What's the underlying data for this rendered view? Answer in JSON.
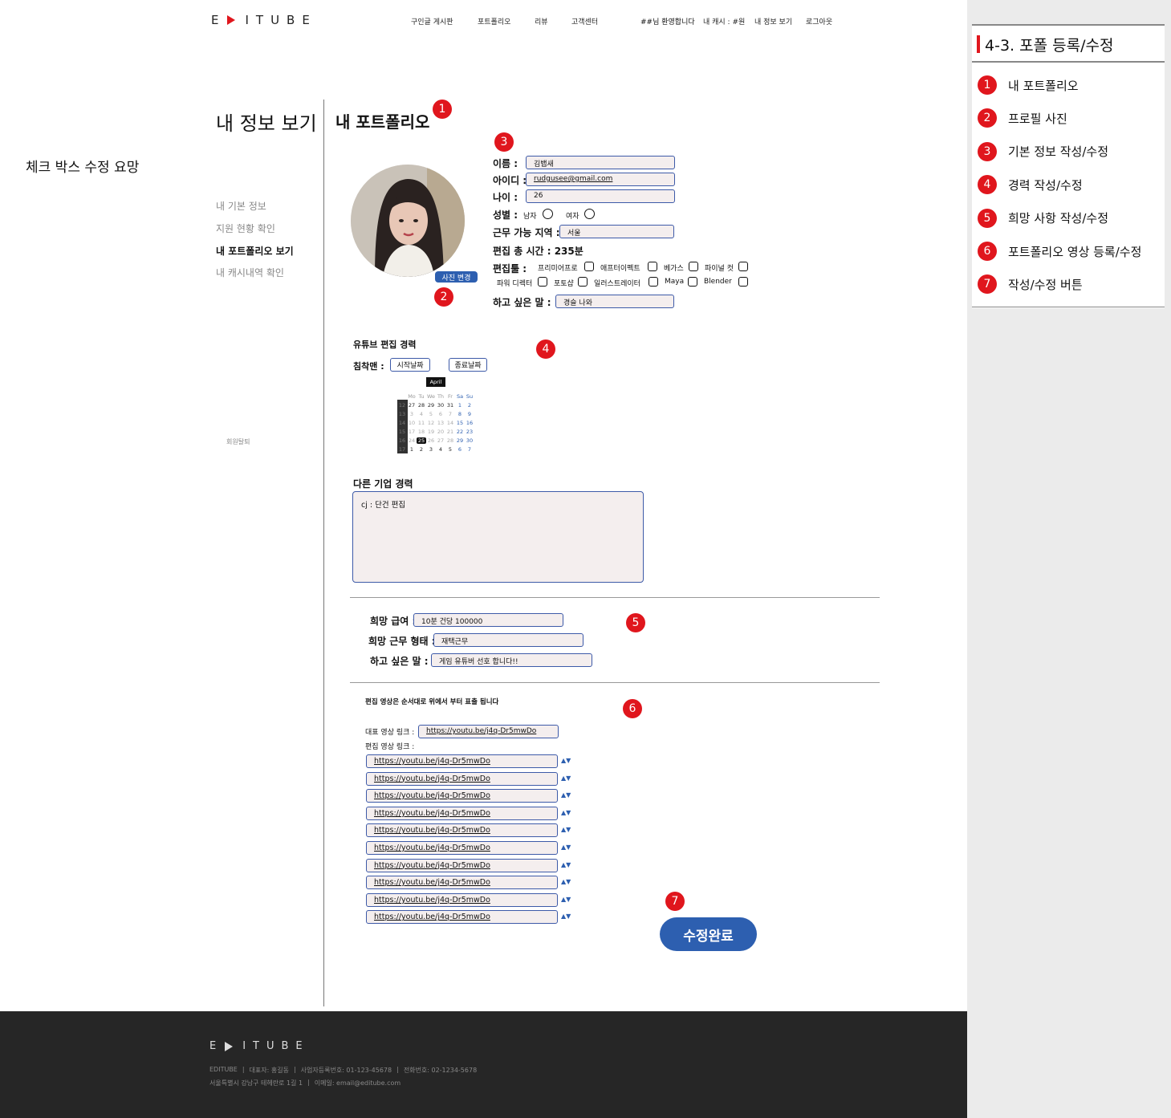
{
  "header": {
    "logo_left": "E",
    "logo_right": "ITUBE",
    "nav": [
      "구인글 게시판",
      "포트폴리오",
      "리뷰",
      "고객센터"
    ],
    "welcome": "##님 환영합니다",
    "cash": "내 캐시 : #원",
    "my_info": "내 정보 보기",
    "logout": "로그아웃"
  },
  "note": "체크 박스 수정 요망",
  "sidebar": {
    "title": "내 정보 보기",
    "items": [
      "내 기본 정보",
      "지원 현황 확인",
      "내 포트폴리오 보기",
      "내 캐시내역 확인"
    ],
    "active_index": 2,
    "withdraw": "회원탈퇴"
  },
  "main": {
    "title": "내 포트폴리오",
    "photo_button": "사진 변경",
    "basic": {
      "name_label": "이름 :",
      "name": "김뱁새",
      "id_label": "아이디 :",
      "id": "rudgusee@gmail.com",
      "age_label": "나이 :",
      "age": "26",
      "gender_label": "성별 :",
      "male": "남자",
      "female": "여자",
      "region_label": "근무 가능 지역 :",
      "region": "서울",
      "hours_label": "편집 총 시간 : 235분",
      "tools_label": "편집툴 :",
      "tools": [
        "프리미어프로",
        "애프터이펙트",
        "베가스",
        "파이널 컷",
        "파워 디렉터",
        "포토샵",
        "일러스트레이터",
        "Maya",
        "Blender"
      ],
      "message_label": "하고 싶은 말 :",
      "message": "경슬 나와"
    },
    "career": {
      "title": "유튜브 편집 경력",
      "channel_label": "침착맨 :",
      "start_button": "시작날짜",
      "end_button": "종료날짜",
      "calendar": {
        "month": "April",
        "weekdays": [
          "Mo",
          "Tu",
          "We",
          "Th",
          "Fr",
          "Sa",
          "Su"
        ],
        "weeks": [
          "12",
          "13",
          "14",
          "15",
          "16",
          "17",
          "18"
        ],
        "days": [
          [
            "27",
            "28",
            "29",
            "30",
            "31",
            "1",
            "2"
          ],
          [
            "3",
            "4",
            "5",
            "6",
            "7",
            "8",
            "9"
          ],
          [
            "10",
            "11",
            "12",
            "13",
            "14",
            "15",
            "16"
          ],
          [
            "17",
            "18",
            "19",
            "20",
            "21",
            "22",
            "23"
          ],
          [
            "24",
            "25",
            "26",
            "27",
            "28",
            "29",
            "30"
          ],
          [
            "1",
            "2",
            "3",
            "4",
            "5",
            "6",
            "7"
          ]
        ],
        "selected": "25"
      },
      "other_title": "다른 기업 경력",
      "other_text": "cj : 단건 편집"
    },
    "wish": {
      "salary_label": "희망 급여 :",
      "salary": "10분 건당 100000",
      "type_label": "희망 근무 형태 :",
      "type": "재택근무",
      "message_label": "하고 싶은 말 :",
      "message": "게임 유튜버 선호 합니다!!"
    },
    "videos": {
      "note": "편집 영상은 순서대로 위에서 부터 표출 됩니다",
      "main_label": "대표 영상 링크 :",
      "main_link": "https://youtu.be/j4q-Dr5mwDo",
      "edit_label": "편집 영상 링크 :",
      "links": [
        "https://youtu.be/j4q-Dr5mwDo",
        "https://youtu.be/j4q-Dr5mwDo",
        "https://youtu.be/j4q-Dr5mwDo",
        "https://youtu.be/j4q-Dr5mwDo",
        "https://youtu.be/j4q-Dr5mwDo",
        "https://youtu.be/j4q-Dr5mwDo",
        "https://youtu.be/j4q-Dr5mwDo",
        "https://youtu.be/j4q-Dr5mwDo",
        "https://youtu.be/j4q-Dr5mwDo",
        "https://youtu.be/j4q-Dr5mwDo"
      ],
      "arrows": "▲▼"
    },
    "submit": "수정완료"
  },
  "badges": [
    "1",
    "2",
    "3",
    "4",
    "5",
    "6",
    "7"
  ],
  "footer": {
    "logo_left": "E",
    "logo_right": "ITUBE",
    "line1": [
      "EDITUBE",
      "대표자: 홍길동",
      "사업자등록번호: 01-123-45678",
      "전화번호: 02-1234-5678"
    ],
    "line2": [
      "서울특별시 강남구 테헤란로 1길 1",
      "이메일: email@editube.com"
    ]
  },
  "side_panel": {
    "title": "4-3. 포폴 등록/수정",
    "items": [
      "내 포트폴리오",
      "프로필 사진",
      "기본 정보 작성/수정",
      "경력 작성/수정",
      "희망 사항 작성/수정",
      "포트폴리오 영상 등록/수정",
      "작성/수정 버튼"
    ]
  },
  "colors": {
    "accent": "#e0161d",
    "primary": "#2d5fb0",
    "footer_bg": "#262626"
  }
}
